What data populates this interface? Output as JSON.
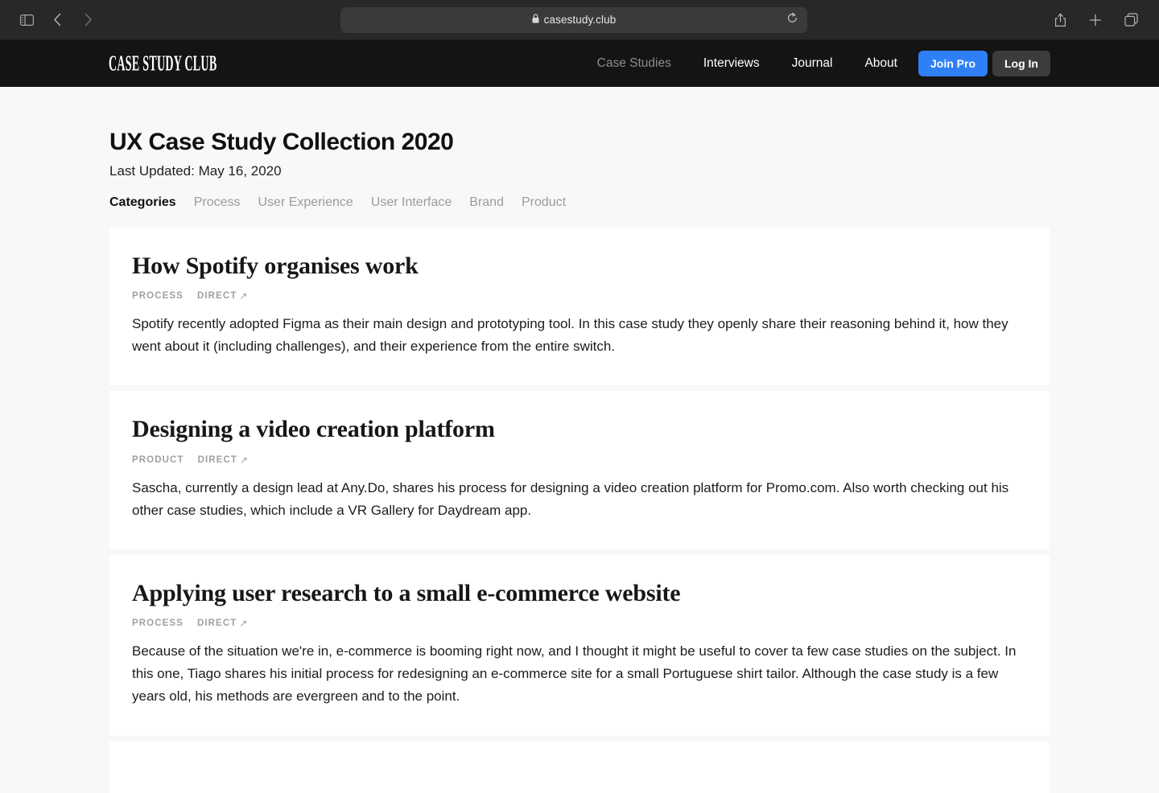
{
  "browser": {
    "sidebar_toggle_icon": "sidebar-toggle-icon",
    "back_icon": "back-chevron-icon",
    "forward_icon": "forward-chevron-icon",
    "shield_icon": "privacy-shield-icon",
    "lock_icon": "lock-icon",
    "url": "casestudy.club",
    "reload_icon": "reload-icon",
    "share_icon": "share-icon",
    "new_tab_icon": "plus-icon",
    "tabs_icon": "tab-overview-icon"
  },
  "header": {
    "logo": "CASE STUDY CLUB",
    "nav": [
      {
        "label": "Case Studies",
        "active": true
      },
      {
        "label": "Interviews",
        "active": false
      },
      {
        "label": "Journal",
        "active": false
      },
      {
        "label": "About",
        "active": false
      }
    ],
    "join_label": "Join Pro",
    "login_label": "Log In",
    "join_color": "#2f80f7",
    "login_color": "#3c3c3c",
    "background": "#141414"
  },
  "main": {
    "title": "UX Case Study Collection 2020",
    "last_updated": "Last Updated: May 16, 2020",
    "categories_label": "Categories",
    "categories": [
      "Process",
      "User Experience",
      "User Interface",
      "Brand",
      "Product"
    ],
    "cards": [
      {
        "title": "How Spotify organises work",
        "category": "PROCESS",
        "link_label": "DIRECT",
        "link_arrow": "↗",
        "description": "Spotify recently adopted Figma as their main design and prototyping tool. In this case study they openly share their reasoning behind it, how they went about it (including challenges), and their experience from the entire switch."
      },
      {
        "title": "Designing a video creation platform",
        "category": "PRODUCT",
        "link_label": "DIRECT",
        "link_arrow": "↗",
        "description": "Sascha, currently a design lead at Any.Do, shares his process for designing a video creation platform for Promo.com. Also worth checking out his other case studies, which include a VR Gallery for Daydream app."
      },
      {
        "title": "Applying user research to a small e-commerce website",
        "category": "PROCESS",
        "link_label": "DIRECT",
        "link_arrow": "↗",
        "description": "Because of the situation we're in, e-commerce is booming right now, and I thought it might be useful to cover ta few case studies on the subject. In this one, Tiago shares his initial process for redesigning an e-commerce site for a small Portuguese shirt tailor. Although the case study is a few years old, his methods are evergreen and to the point."
      }
    ]
  }
}
